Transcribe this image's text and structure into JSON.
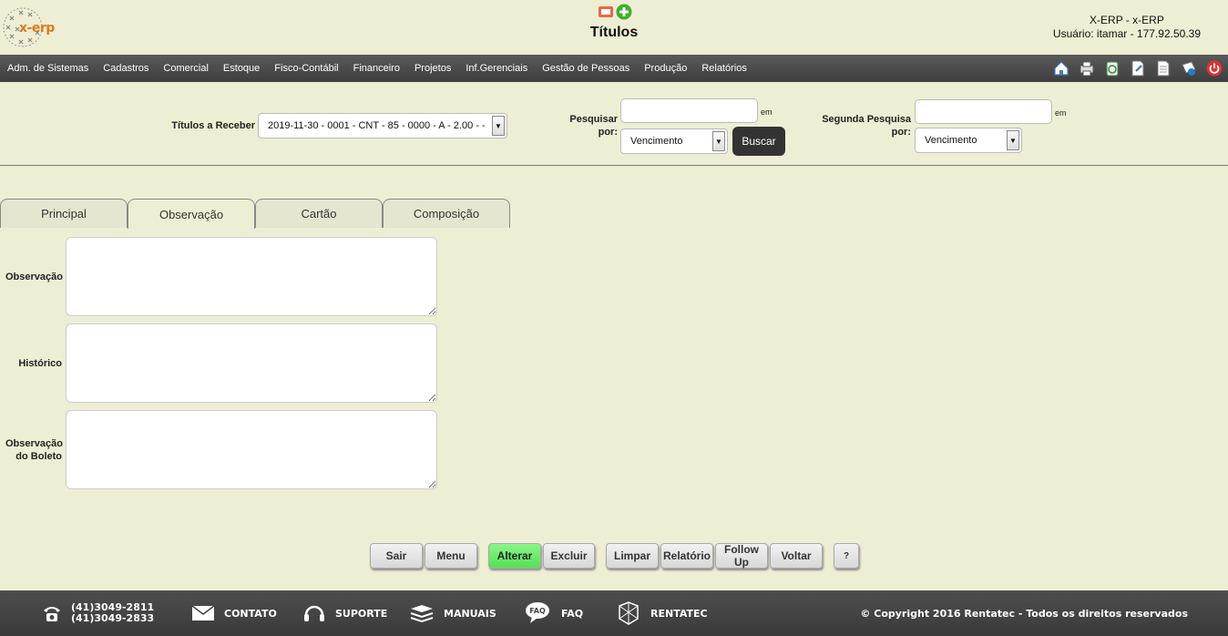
{
  "header": {
    "logo_text": "x-erp",
    "page_title": "Títulos",
    "system_name": "X-ERP - x-ERP",
    "user_info": "Usuário: itamar - 177.92.50.39"
  },
  "menu": {
    "items": [
      "Adm. de Sistemas",
      "Cadastros",
      "Comercial",
      "Estoque",
      "Fisco-Contábil",
      "Financeiro",
      "Projetos",
      "Inf.Gerenciais",
      "Gestão de Pessoas",
      "Produção",
      "Relatórios"
    ]
  },
  "search": {
    "titulos_label": "Títulos a Receber",
    "titulos_value": "2019-11-30 - 0001 - CNT - 85 - 0000 - A - 2.00 - -",
    "pesquisar_label_1": "Pesquisar",
    "pesquisar_label_2": "por:",
    "pesquisar_value": "",
    "em_label": "em",
    "pesquisar_field": "Vencimento",
    "buscar_label": "Buscar",
    "segunda_label_1": "Segunda Pesquisa",
    "segunda_label_2": "por:",
    "segunda_value": "",
    "segunda_em_label": "em",
    "segunda_field": "Vencimento"
  },
  "tabs": [
    {
      "label": "Principal"
    },
    {
      "label": "Observação"
    },
    {
      "label": "Cartão"
    },
    {
      "label": "Composição"
    }
  ],
  "fields": {
    "observacao_label": "Observação",
    "observacao_value": "",
    "historico_label": "Histórico",
    "historico_value": "",
    "obs_boleto_label_1": "Observação",
    "obs_boleto_label_2": "do Boleto",
    "obs_boleto_value": ""
  },
  "buttons": {
    "sair": "Sair",
    "menu": "Menu",
    "alterar": "Alterar",
    "excluir": "Excluir",
    "limpar": "Limpar",
    "relatorio": "Relatório",
    "follow_up": "Follow Up",
    "voltar": "Voltar",
    "help": "?"
  },
  "footer": {
    "phone_1": "(41)3049-2811",
    "phone_2": "(41)3049-2833",
    "contato": "CONTATO",
    "suporte": "SUPORTE",
    "manuais": "MANUAIS",
    "faq": "FAQ",
    "faq_icon_text": "FAQ",
    "rentatec": "RENTATEC",
    "copyright": "© Copyright 2016 Rentatec - Todos os direitos reservados"
  },
  "colors": {
    "background": "#eeeed4",
    "menubar": "#474747",
    "accent_green": "#66e866",
    "logo_orange": "#e07a1a"
  }
}
